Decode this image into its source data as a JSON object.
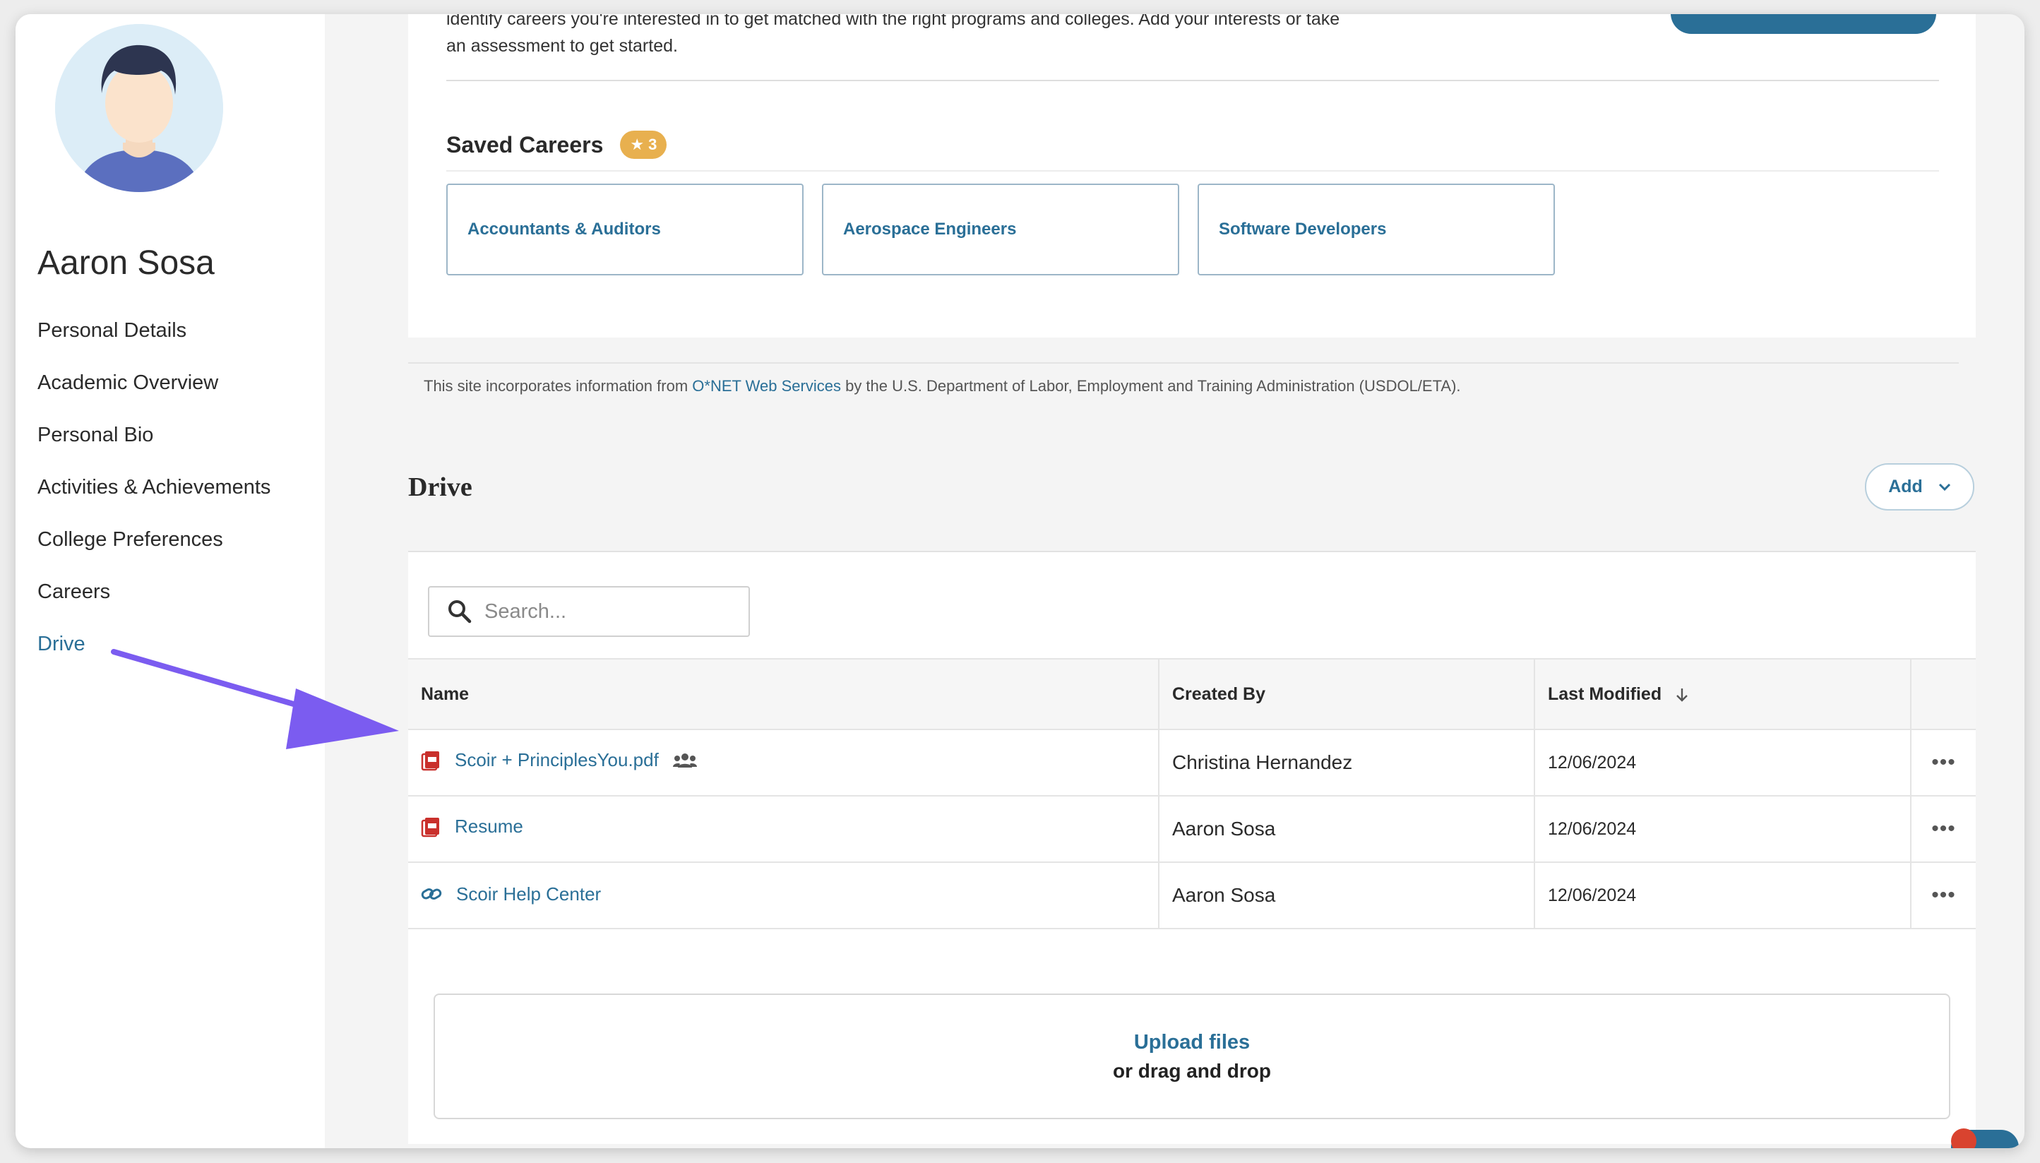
{
  "sidebar": {
    "user_name": "Aaron Sosa",
    "nav": [
      {
        "label": "Personal Details",
        "active": false
      },
      {
        "label": "Academic Overview",
        "active": false
      },
      {
        "label": "Personal Bio",
        "active": false
      },
      {
        "label": "Activities & Achievements",
        "active": false
      },
      {
        "label": "College Preferences",
        "active": false
      },
      {
        "label": "Careers",
        "active": false
      },
      {
        "label": "Drive",
        "active": true
      }
    ]
  },
  "careers": {
    "intro_line1": "identify careers you're interested in to get matched with the right programs and colleges. Add your interests or take",
    "intro_line2": "an assessment to get started.",
    "saved_title": "Saved Careers",
    "saved_count": "3",
    "saved": [
      "Accountants & Auditors",
      "Aerospace Engineers",
      "Software Developers"
    ]
  },
  "footnote": {
    "prefix": "This site incorporates information from ",
    "link": "O*NET Web Services",
    "suffix": " by the U.S. Department of Labor, Employment and Training Administration (USDOL/ETA)."
  },
  "drive": {
    "title": "Drive",
    "add_label": "Add",
    "search_placeholder": "Search...",
    "columns": {
      "name": "Name",
      "created_by": "Created By",
      "last_modified": "Last Modified"
    },
    "rows": [
      {
        "name": "Scoir + PrinciplesYou.pdf",
        "icon": "pdf-icon",
        "shared": true,
        "created_by": "Christina Hernandez",
        "last_modified": "12/06/2024"
      },
      {
        "name": "Resume",
        "icon": "pdf-icon",
        "shared": false,
        "created_by": "Aaron Sosa",
        "last_modified": "12/06/2024"
      },
      {
        "name": "Scoir Help Center",
        "icon": "link-icon",
        "shared": false,
        "created_by": "Aaron Sosa",
        "last_modified": "12/06/2024"
      }
    ],
    "upload_link": "Upload files",
    "upload_sub": "or drag and drop"
  },
  "colors": {
    "accent": "#2a6f97",
    "badge": "#e8b04f",
    "pdf": "#c9302c",
    "arrow": "#7b5cf0"
  }
}
